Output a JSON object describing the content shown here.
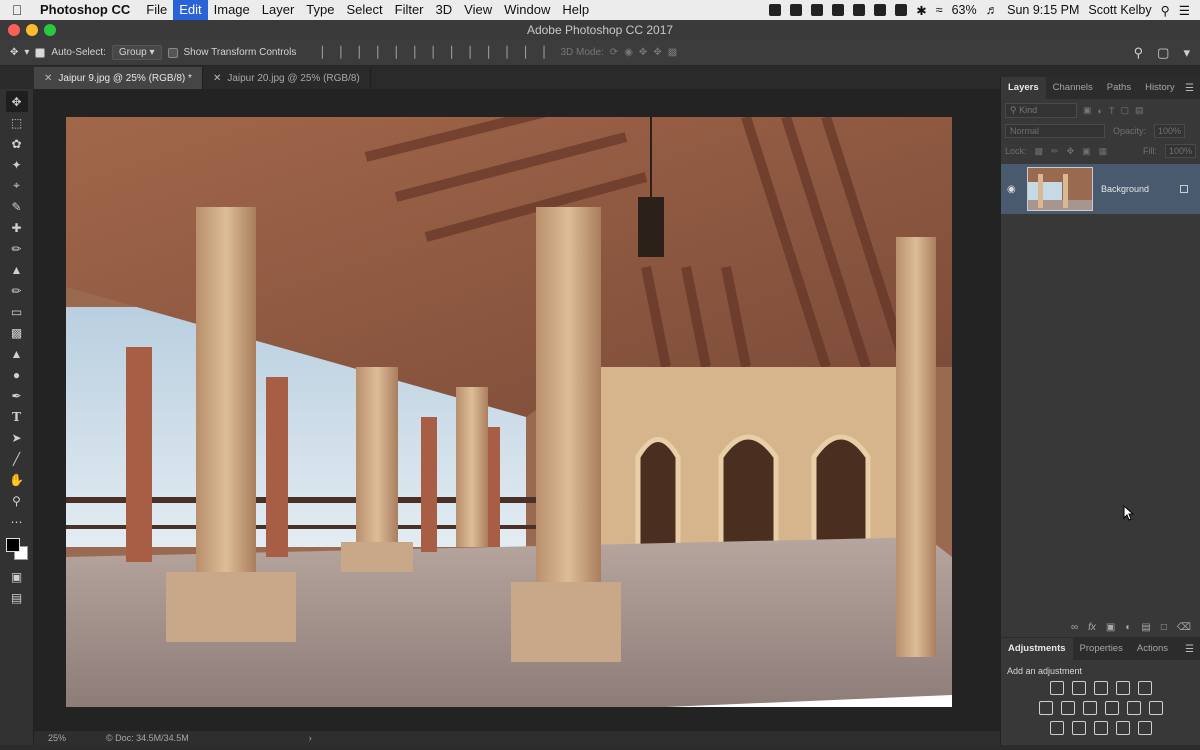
{
  "menubar": {
    "app": "Photoshop CC",
    "items": [
      "File",
      "Edit",
      "Image",
      "Layer",
      "Type",
      "Select",
      "Filter",
      "3D",
      "View",
      "Window",
      "Help"
    ],
    "active": "Edit",
    "battery": "63%",
    "clock": "Sun 9:15 PM",
    "user": "Scott Kelby"
  },
  "window": {
    "title": "Adobe Photoshop CC 2017"
  },
  "options": {
    "auto_select_label": "Auto-Select:",
    "auto_select_value": "Group",
    "show_transform_label": "Show Transform Controls",
    "mode_label": "3D Mode:"
  },
  "tabs": [
    {
      "label": "Jaipur 9.jpg @ 25% (RGB/8) *",
      "active": true
    },
    {
      "label": "Jaipur 20.jpg @ 25% (RGB/8)",
      "active": false
    }
  ],
  "status": {
    "zoom": "25%",
    "doc": "Doc: 34.5M/34.5M"
  },
  "layers_panel": {
    "tabs": [
      "Layers",
      "Channels",
      "Paths",
      "History"
    ],
    "kind_placeholder": "Kind",
    "blend_mode": "Normal",
    "opacity_label": "Opacity:",
    "opacity_value": "100%",
    "lock_label": "Lock:",
    "fill_label": "Fill:",
    "fill_value": "100%",
    "layer": {
      "name": "Background"
    }
  },
  "adjustments_panel": {
    "tabs": [
      "Adjustments",
      "Properties",
      "Actions"
    ],
    "add_label": "Add an adjustment"
  },
  "colors": {
    "menu_highlight": "#2a62d9",
    "panel_bg": "#383838",
    "selected_layer": "#4a5a6e"
  }
}
